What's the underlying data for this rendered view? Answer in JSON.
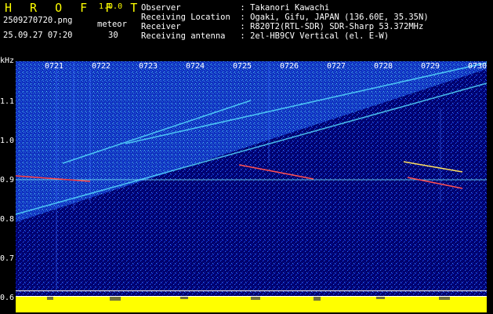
{
  "header": {
    "brand": "H R O F F T",
    "version": "1.0.0",
    "filename": "2509270720.png",
    "datetime": "25.09.27 07:20",
    "mode_label": "meteor",
    "mode_count": "30"
  },
  "info": {
    "observer": "Observer            : Takanori Kawachi",
    "location": "Receiving Location  : Ogaki, Gifu, JAPAN (136.60E, 35.35N)",
    "receiver": "Receiver            : R820T2(RTL-SDR) SDR-Sharp 53.372MHz",
    "antenna": "Receiving antenna   : 2el-HB9CV Vertical (el. E-W)"
  },
  "axis": {
    "unit": "kHz",
    "y_ticks": [
      "1.1",
      "1.0",
      "0.9",
      "0.8",
      "0.7",
      "0.6"
    ],
    "x_ticks": [
      "0721",
      "0722",
      "0723",
      "0724",
      "0725",
      "0726",
      "0727",
      "0728",
      "0729",
      "0730"
    ]
  },
  "colors": {
    "background": "#000000",
    "spectrogram_base": "#00006e",
    "title": "#ffff00",
    "text": "#ffffff",
    "signal_line": "#7fffff",
    "meteor_echo": "#ff4040",
    "level_bars": "#ffff00"
  }
}
